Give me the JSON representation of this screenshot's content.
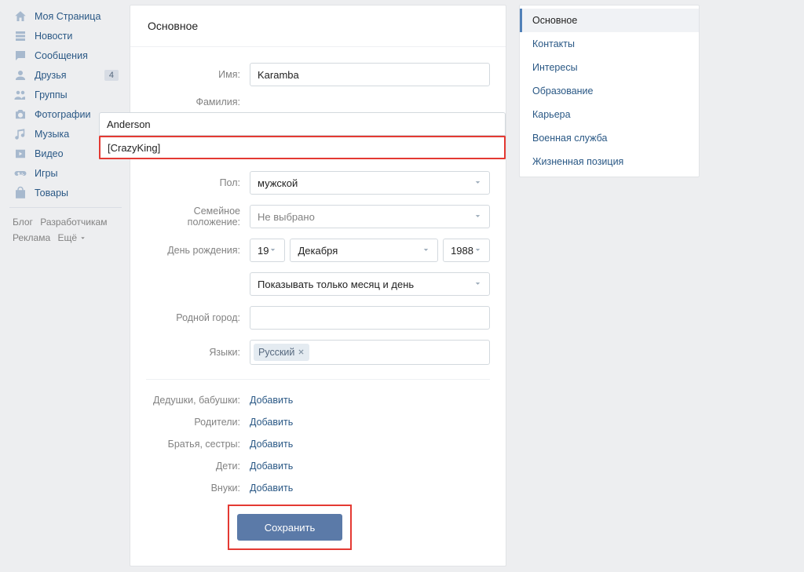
{
  "left_nav": {
    "items": [
      {
        "label": "Моя Страница",
        "icon": "home"
      },
      {
        "label": "Новости",
        "icon": "feed"
      },
      {
        "label": "Сообщения",
        "icon": "msg"
      },
      {
        "label": "Друзья",
        "icon": "user",
        "badge": "4"
      },
      {
        "label": "Группы",
        "icon": "group"
      },
      {
        "label": "Фотографии",
        "icon": "camera"
      },
      {
        "label": "Музыка",
        "icon": "music"
      },
      {
        "label": "Видео",
        "icon": "video"
      },
      {
        "label": "Игры",
        "icon": "games"
      },
      {
        "label": "Товары",
        "icon": "bag"
      }
    ],
    "footer": {
      "blog": "Блог",
      "devs": "Разработчикам",
      "ads": "Реклама",
      "more": "Ещё"
    }
  },
  "main": {
    "title": "Основное",
    "labels": {
      "first_name": "Имя:",
      "last_name": "Фамилия:",
      "gender": "Пол:",
      "relationship": "Семейное положение:",
      "birthday": "День рождения:",
      "hometown": "Родной город:",
      "languages": "Языки:"
    },
    "values": {
      "first_name": "Karamba",
      "last_name": "Anderson",
      "nickname": "[CrazyKing]",
      "gender": "мужской",
      "relationship": "Не выбрано",
      "bday_day": "19",
      "bday_month": "Декабря",
      "bday_year": "1988",
      "bday_visibility": "Показывать только месяц и день",
      "hometown": "",
      "language_chip": "Русский"
    },
    "family_labels": {
      "grandparents": "Дедушки, бабушки:",
      "parents": "Родители:",
      "siblings": "Братья, сестры:",
      "children": "Дети:",
      "grandchildren": "Внуки:"
    },
    "add_label": "Добавить",
    "save_label": "Сохранить"
  },
  "right_nav": {
    "items": [
      "Основное",
      "Контакты",
      "Интересы",
      "Образование",
      "Карьера",
      "Военная служба",
      "Жизненная позиция"
    ],
    "active_index": 0
  }
}
